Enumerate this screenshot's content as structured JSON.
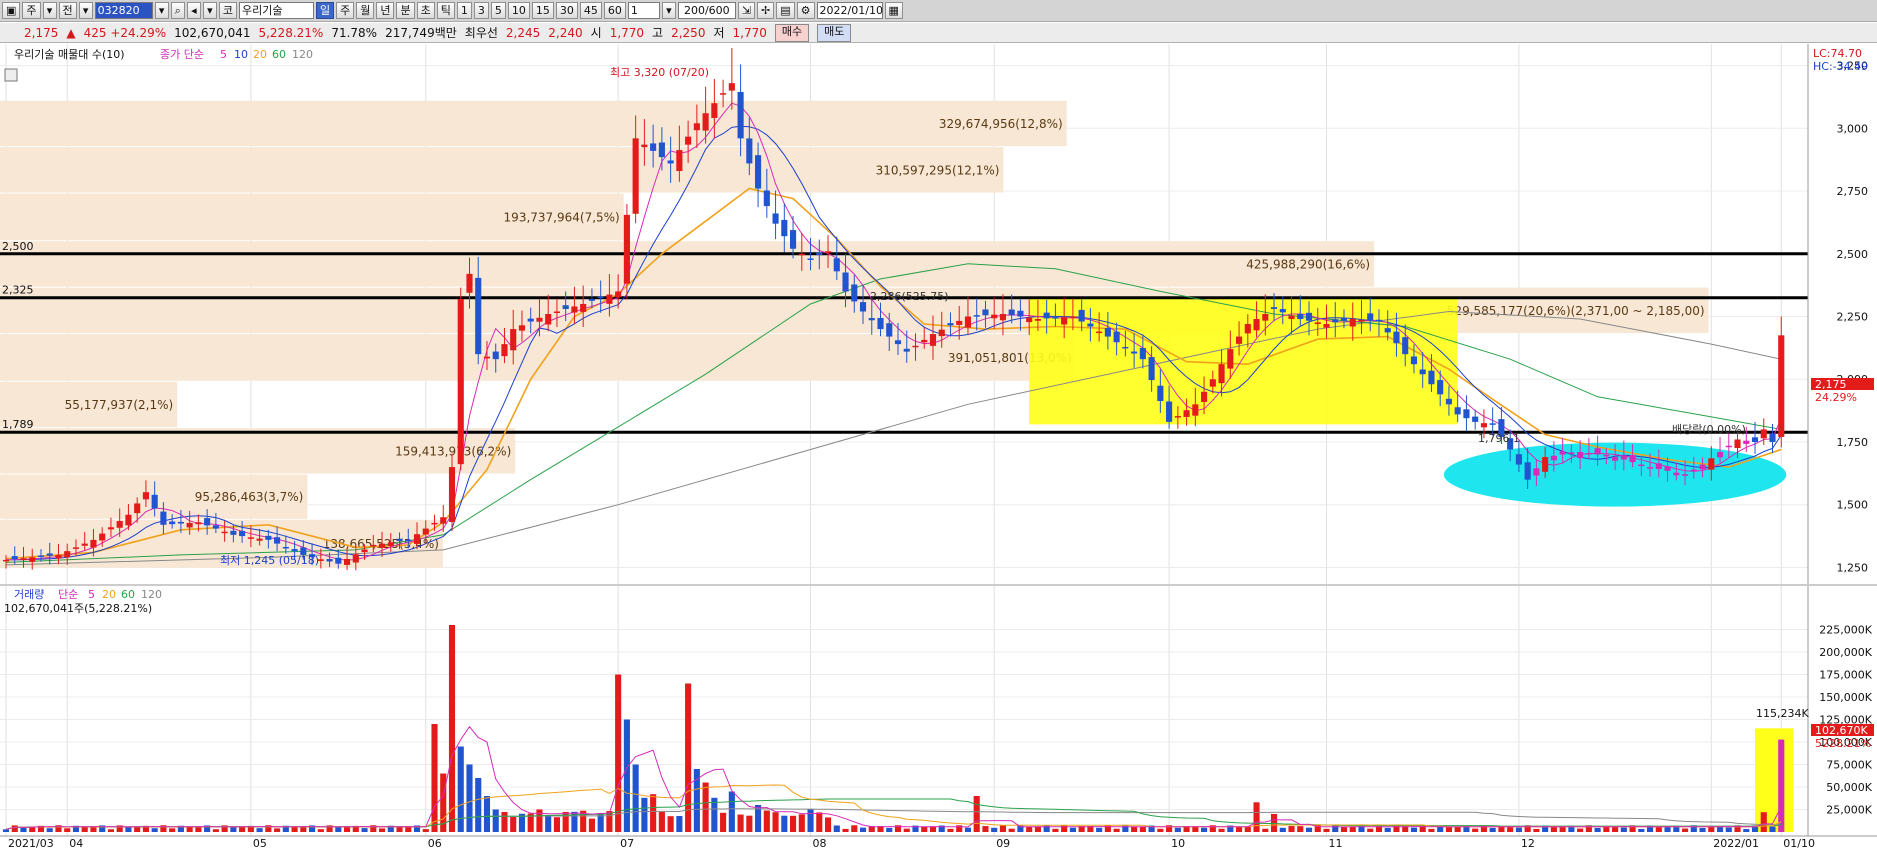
{
  "toolbar": {
    "items": [
      "주",
      "전"
    ],
    "code": "032820",
    "market": "코",
    "stock_name": "우리기술",
    "periods": [
      "일",
      "주",
      "월",
      "년",
      "분",
      "초",
      "틱"
    ],
    "minutes": [
      "1",
      "3",
      "5",
      "10",
      "15",
      "30",
      "45",
      "60"
    ],
    "custom_period": "1",
    "display_count": "200/600",
    "date": "2022/01/10"
  },
  "quote": {
    "price": "2,175",
    "change": "425 +24.29%",
    "volume": "102,670,041",
    "volume_ratio": "5,228.21%",
    "turnover": "71.78%",
    "trade_value": "217,749백만",
    "best_ask_label": "최우선",
    "best_ask": "2,245",
    "best_bid": "2,240",
    "open_label": "시",
    "open": "1,770",
    "high_label": "고",
    "high": "2,250",
    "low_label": "저",
    "low": "1,770",
    "buy_label": "매수",
    "sell_label": "매도"
  },
  "colors": {
    "up": "#e41b1b",
    "down": "#2155d0",
    "ma5": "#d62bb8",
    "ma10": "#1b3fd0",
    "ma20": "#f0a21b",
    "ma60": "#2aa14a",
    "ma120": "#888888",
    "highlight_yellow": "#ffff1a",
    "highlight_cyan": "#1fe6ee",
    "profile_band": "#f7e7d4"
  },
  "price_panel": {
    "legend_title": "우리기술 매물대 수(10)",
    "ma_legend_prefix": "종가 단순",
    "ma_periods": [
      "5",
      "10",
      "20",
      "60",
      "120"
    ],
    "lc_label": "LC:74.70",
    "hc_label": "HC:-34.49",
    "current_price_label": "2,175",
    "current_change_label": "24.29%",
    "high_annotation": "최고 3,320 (07/20)",
    "low_annotation": "최저 1,245 (05/18)",
    "line_labels": [
      "2,500",
      "2,325",
      "1,789"
    ],
    "ex_dividend_label": "배당락(0.00%)",
    "partial_labels": [
      "2,286(525.75)",
      "1,796.1"
    ]
  },
  "volume_panel": {
    "legend_title": "거래량",
    "ma_legend_prefix": "단순",
    "ma_periods": [
      "5",
      "20",
      "60",
      "120"
    ],
    "subtitle": "102,670,041주(5,228.21%)",
    "peak_label": "115,234K",
    "current_label": "102,670K",
    "current_pct": "5228.21%"
  },
  "chart_data": [
    {
      "type": "candlestick",
      "title": "우리기술 매물대 수(10)",
      "ylim": [
        1200,
        3320
      ],
      "y_ticks": [
        1250,
        1500,
        1750,
        2000,
        2250,
        2500,
        2750,
        3000,
        3250
      ],
      "x_labels": [
        {
          "label": "2021/03",
          "day": 0
        },
        {
          "label": "04",
          "day": 7
        },
        {
          "label": "05",
          "day": 28
        },
        {
          "label": "06",
          "day": 48
        },
        {
          "label": "07",
          "day": 70
        },
        {
          "label": "08",
          "day": 92
        },
        {
          "label": "09",
          "day": 113
        },
        {
          "label": "10",
          "day": 133
        },
        {
          "label": "11",
          "day": 151
        },
        {
          "label": "12",
          "day": 173
        },
        {
          "label": "2022/01",
          "day": 195
        },
        {
          "label": "01/10",
          "day": 203
        }
      ],
      "price_path": [
        [
          0,
          1280
        ],
        [
          6,
          1300
        ],
        [
          10,
          1360
        ],
        [
          14,
          1460
        ],
        [
          16,
          1550
        ],
        [
          18,
          1420
        ],
        [
          22,
          1430
        ],
        [
          26,
          1380
        ],
        [
          30,
          1360
        ],
        [
          34,
          1300
        ],
        [
          38,
          1265
        ],
        [
          42,
          1340
        ],
        [
          46,
          1360
        ],
        [
          50,
          1450
        ],
        [
          51,
          1650
        ],
        [
          52,
          2320
        ],
        [
          53,
          2420
        ],
        [
          54,
          2100
        ],
        [
          56,
          2080
        ],
        [
          58,
          2200
        ],
        [
          62,
          2260
        ],
        [
          66,
          2300
        ],
        [
          70,
          2350
        ],
        [
          72,
          2960
        ],
        [
          74,
          2910
        ],
        [
          76,
          2860
        ],
        [
          79,
          3020
        ],
        [
          81,
          3100
        ],
        [
          83,
          3180
        ],
        [
          84,
          2960
        ],
        [
          86,
          2760
        ],
        [
          88,
          2620
        ],
        [
          90,
          2520
        ],
        [
          92,
          2480
        ],
        [
          94,
          2510
        ],
        [
          96,
          2350
        ],
        [
          98,
          2270
        ],
        [
          100,
          2200
        ],
        [
          103,
          2110
        ],
        [
          106,
          2180
        ],
        [
          110,
          2250
        ],
        [
          114,
          2260
        ],
        [
          118,
          2240
        ],
        [
          122,
          2250
        ],
        [
          126,
          2170
        ],
        [
          130,
          2080
        ],
        [
          133,
          1830
        ],
        [
          136,
          1900
        ],
        [
          138,
          2000
        ],
        [
          140,
          2120
        ],
        [
          142,
          2220
        ],
        [
          145,
          2280
        ],
        [
          148,
          2240
        ],
        [
          151,
          2220
        ],
        [
          154,
          2240
        ],
        [
          157,
          2230
        ],
        [
          160,
          2100
        ],
        [
          163,
          1980
        ],
        [
          166,
          1860
        ],
        [
          168,
          1830
        ],
        [
          170,
          1820
        ],
        [
          172,
          1720
        ],
        [
          174,
          1600
        ],
        [
          176,
          1690
        ],
        [
          180,
          1710
        ],
        [
          184,
          1690
        ],
        [
          188,
          1650
        ],
        [
          192,
          1620
        ],
        [
          194,
          1660
        ],
        [
          196,
          1710
        ],
        [
          198,
          1760
        ],
        [
          200,
          1750
        ],
        [
          201,
          1800
        ],
        [
          202,
          1750
        ],
        [
          203,
          2175
        ]
      ],
      "ma20_path": [
        [
          0,
          1285
        ],
        [
          10,
          1310
        ],
        [
          20,
          1400
        ],
        [
          30,
          1420
        ],
        [
          40,
          1330
        ],
        [
          46,
          1340
        ],
        [
          50,
          1430
        ],
        [
          55,
          1640
        ],
        [
          60,
          2000
        ],
        [
          65,
          2250
        ],
        [
          70,
          2340
        ],
        [
          75,
          2500
        ],
        [
          80,
          2630
        ],
        [
          85,
          2760
        ],
        [
          90,
          2720
        ],
        [
          95,
          2560
        ],
        [
          100,
          2370
        ],
        [
          105,
          2220
        ],
        [
          112,
          2200
        ],
        [
          120,
          2210
        ],
        [
          128,
          2200
        ],
        [
          135,
          2070
        ],
        [
          142,
          2060
        ],
        [
          150,
          2160
        ],
        [
          158,
          2170
        ],
        [
          165,
          2040
        ],
        [
          170,
          1920
        ],
        [
          176,
          1780
        ],
        [
          182,
          1730
        ],
        [
          190,
          1680
        ],
        [
          197,
          1650
        ],
        [
          203,
          1720
        ]
      ],
      "ma60_path": [
        [
          0,
          1270
        ],
        [
          20,
          1300
        ],
        [
          40,
          1320
        ],
        [
          50,
          1380
        ],
        [
          60,
          1600
        ],
        [
          70,
          1810
        ],
        [
          80,
          2020
        ],
        [
          92,
          2300
        ],
        [
          100,
          2400
        ],
        [
          110,
          2460
        ],
        [
          120,
          2440
        ],
        [
          132,
          2350
        ],
        [
          145,
          2260
        ],
        [
          160,
          2210
        ],
        [
          172,
          2080
        ],
        [
          182,
          1930
        ],
        [
          195,
          1850
        ],
        [
          203,
          1800
        ]
      ],
      "ma120_path": [
        [
          0,
          1260
        ],
        [
          30,
          1290
        ],
        [
          50,
          1320
        ],
        [
          70,
          1500
        ],
        [
          90,
          1700
        ],
        [
          110,
          1900
        ],
        [
          130,
          2050
        ],
        [
          150,
          2200
        ],
        [
          165,
          2270
        ],
        [
          180,
          2240
        ],
        [
          195,
          2140
        ],
        [
          203,
          2080
        ]
      ],
      "volume_profile": [
        {
          "label": "329,674,956(12,8%)",
          "price_top": 3110,
          "price_bottom": 2925,
          "width_frac": 0.59
        },
        {
          "label": "310,597,295(12,1%)",
          "price_top": 2925,
          "price_bottom": 2740,
          "width_frac": 0.555
        },
        {
          "label": "193,737,964(7,5%)",
          "price_top": 2740,
          "price_bottom": 2550,
          "width_frac": 0.345
        },
        {
          "label": "425,988,290(16,6%)",
          "price_top": 2550,
          "price_bottom": 2365,
          "width_frac": 0.76
        },
        {
          "label": "529,585,177(20,6%)(2,371,00 ~ 2,185,00)",
          "price_top": 2365,
          "price_bottom": 2180,
          "width_frac": 0.945
        },
        {
          "label": "391,051,801(13,0%)",
          "price_top": 2180,
          "price_bottom": 1990,
          "width_frac": 0.595
        },
        {
          "label": "55,177,937(2,1%)",
          "price_top": 1990,
          "price_bottom": 1805,
          "width_frac": 0.098
        },
        {
          "label": "159,413,973(6,2%)",
          "price_top": 1805,
          "price_bottom": 1620,
          "width_frac": 0.285
        },
        {
          "label": "95,286,463(3,7%)",
          "price_top": 1620,
          "price_bottom": 1440,
          "width_frac": 0.17
        },
        {
          "label": "138,665,525(5,4%)",
          "price_top": 1440,
          "price_bottom": 1245,
          "width_frac": 0.245
        }
      ],
      "horizontal_lines": [
        2500,
        2325,
        1789
      ]
    },
    {
      "type": "bar",
      "title": "거래량",
      "ylim": [
        0,
        240000
      ],
      "y_ticks": [
        25000,
        50000,
        75000,
        100000,
        125000,
        150000,
        175000,
        200000,
        225000
      ],
      "y_tick_labels": [
        "25,000K",
        "50,000K",
        "75,000K",
        "100,000K",
        "125,000K",
        "150,000K",
        "175,000K",
        "200,000K",
        "225,000K"
      ],
      "spikes": [
        {
          "day": 49,
          "value": 120000,
          "up": true
        },
        {
          "day": 50,
          "value": 65000,
          "up": true
        },
        {
          "day": 51,
          "value": 230000,
          "up": true
        },
        {
          "day": 52,
          "value": 95000,
          "up": false
        },
        {
          "day": 53,
          "value": 75000,
          "up": false
        },
        {
          "day": 54,
          "value": 60000,
          "up": false
        },
        {
          "day": 55,
          "value": 40000,
          "up": false
        },
        {
          "day": 70,
          "value": 175000,
          "up": true
        },
        {
          "day": 71,
          "value": 125000,
          "up": false
        },
        {
          "day": 72,
          "value": 75000,
          "up": false
        },
        {
          "day": 73,
          "value": 38000,
          "up": false
        },
        {
          "day": 74,
          "value": 42000,
          "up": true
        },
        {
          "day": 78,
          "value": 165000,
          "up": true
        },
        {
          "day": 79,
          "value": 70000,
          "up": false
        },
        {
          "day": 80,
          "value": 55000,
          "up": true
        },
        {
          "day": 81,
          "value": 38000,
          "up": false
        },
        {
          "day": 83,
          "value": 45000,
          "up": false
        },
        {
          "day": 86,
          "value": 30000,
          "up": false
        },
        {
          "day": 88,
          "value": 22000,
          "up": true
        },
        {
          "day": 111,
          "value": 40000,
          "up": true
        },
        {
          "day": 143,
          "value": 33000,
          "up": true
        },
        {
          "day": 145,
          "value": 20000,
          "up": true
        },
        {
          "day": 201,
          "value": 22000,
          "up": true
        },
        {
          "day": 203,
          "value": 102670,
          "up": true
        }
      ]
    }
  ]
}
